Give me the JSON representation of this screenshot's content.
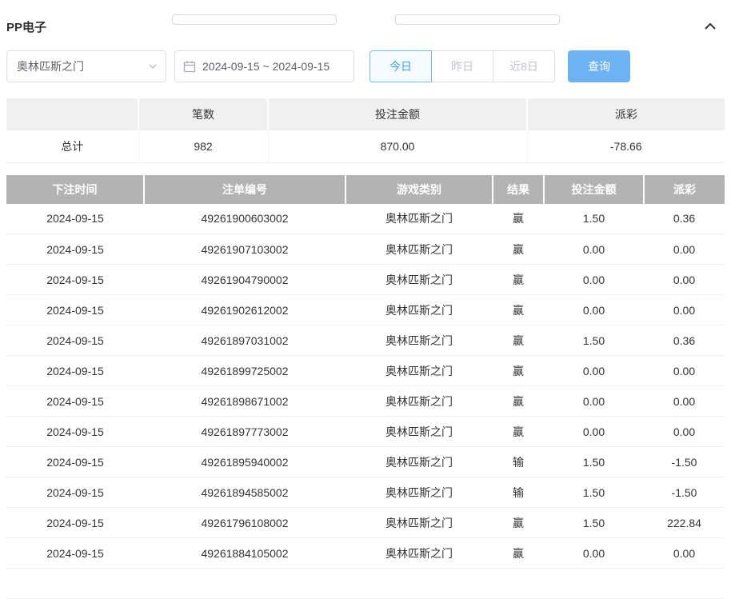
{
  "section": {
    "title": "PP电子"
  },
  "filters": {
    "game_select_value": "奥林匹斯之门",
    "date_range_value": "2024-09-15 ~ 2024-09-15",
    "quick_buttons": [
      {
        "label": "今日",
        "active": true
      },
      {
        "label": "昨日",
        "active": false
      },
      {
        "label": "近8日",
        "active": false
      }
    ],
    "search_label": "查询"
  },
  "summary": {
    "headers": [
      "",
      "笔数",
      "投注金额",
      "派彩"
    ],
    "row": {
      "label": "总计",
      "count": "982",
      "bet_amount": "870.00",
      "payout": "-78.66"
    }
  },
  "table": {
    "headers": [
      "下注时间",
      "注单编号",
      "游戏类别",
      "结果",
      "投注金额",
      "派彩"
    ],
    "rows": [
      [
        "2024-09-15",
        "49261900603002",
        "奥林匹斯之门",
        "赢",
        "1.50",
        "0.36"
      ],
      [
        "2024-09-15",
        "49261907103002",
        "奥林匹斯之门",
        "赢",
        "0.00",
        "0.00"
      ],
      [
        "2024-09-15",
        "49261904790002",
        "奥林匹斯之门",
        "赢",
        "0.00",
        "0.00"
      ],
      [
        "2024-09-15",
        "49261902612002",
        "奥林匹斯之门",
        "赢",
        "0.00",
        "0.00"
      ],
      [
        "2024-09-15",
        "49261897031002",
        "奥林匹斯之门",
        "赢",
        "1.50",
        "0.36"
      ],
      [
        "2024-09-15",
        "49261899725002",
        "奥林匹斯之门",
        "赢",
        "0.00",
        "0.00"
      ],
      [
        "2024-09-15",
        "49261898671002",
        "奥林匹斯之门",
        "赢",
        "0.00",
        "0.00"
      ],
      [
        "2024-09-15",
        "49261897773002",
        "奥林匹斯之门",
        "赢",
        "0.00",
        "0.00"
      ],
      [
        "2024-09-15",
        "49261895940002",
        "奥林匹斯之门",
        "输",
        "1.50",
        "-1.50"
      ],
      [
        "2024-09-15",
        "49261894585002",
        "奥林匹斯之门",
        "输",
        "1.50",
        "-1.50"
      ],
      [
        "2024-09-15",
        "49261796108002",
        "奥林匹斯之门",
        "赢",
        "1.50",
        "222.84"
      ],
      [
        "2024-09-15",
        "49261884105002",
        "奥林匹斯之门",
        "赢",
        "0.00",
        "0.00"
      ]
    ]
  },
  "colors": {
    "accent": "#409eff",
    "query_button": "#6db3f3",
    "danger": "#f56c6c",
    "table_header_bg": "#b3b3b3"
  }
}
